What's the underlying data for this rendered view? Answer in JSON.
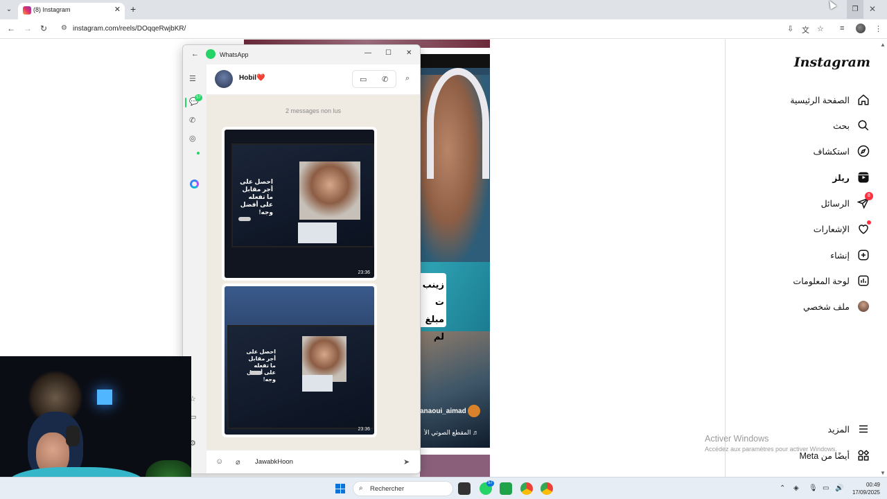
{
  "browser": {
    "tab_title": "(8) Instagram",
    "url": "instagram.com/reels/DOqqeRwjbKR/"
  },
  "instagram": {
    "logo": "Instagram",
    "nav": [
      {
        "label": "الصفحة الرئيسية",
        "icon": "home-icon"
      },
      {
        "label": "بحث",
        "icon": "search-icon"
      },
      {
        "label": "استكشاف",
        "icon": "compass-icon"
      },
      {
        "label": "ريلز",
        "icon": "reels-icon"
      },
      {
        "label": "الرسائل",
        "icon": "messages-icon",
        "badge": "8"
      },
      {
        "label": "الإشعارات",
        "icon": "heart-icon"
      },
      {
        "label": "إنشاء",
        "icon": "create-icon"
      },
      {
        "label": "لوحة المعلومات",
        "icon": "dashboard-icon"
      },
      {
        "label": "ملف شخصي",
        "icon": "profile-avatar"
      }
    ],
    "more_label": "المزيد",
    "also_from_meta_label": "أيضًا من Meta"
  },
  "reel": {
    "caption_lines": [
      "زينب ت",
      "مبلغ",
      "لم"
    ],
    "username": "anaoui_aimad",
    "audio": "♬ المقطع الصوتي الأ"
  },
  "whatsapp": {
    "app_name": "WhatsApp",
    "contact_name": "Hobil❤️",
    "chats_badge": "57",
    "unread_label": "2 messages non lus",
    "messages": [
      {
        "timestamp": "23:36",
        "screen_text": "احصل على أجر مقابل ما تفعله على أفضل وجه!"
      },
      {
        "timestamp": "23:36",
        "screen_text": "احصل على أجر مقابل ما تفعله على أفضل وجه!"
      }
    ],
    "draft_text": "JawabkHoon"
  },
  "watermark": {
    "title": "Activer Windows",
    "subtitle": "Accédez aux paramètres pour activer Windows."
  },
  "taskbar": {
    "search_placeholder": "Rechercher",
    "whatsapp_badge": "57",
    "time": "00:49",
    "date": "17/09/2025"
  }
}
